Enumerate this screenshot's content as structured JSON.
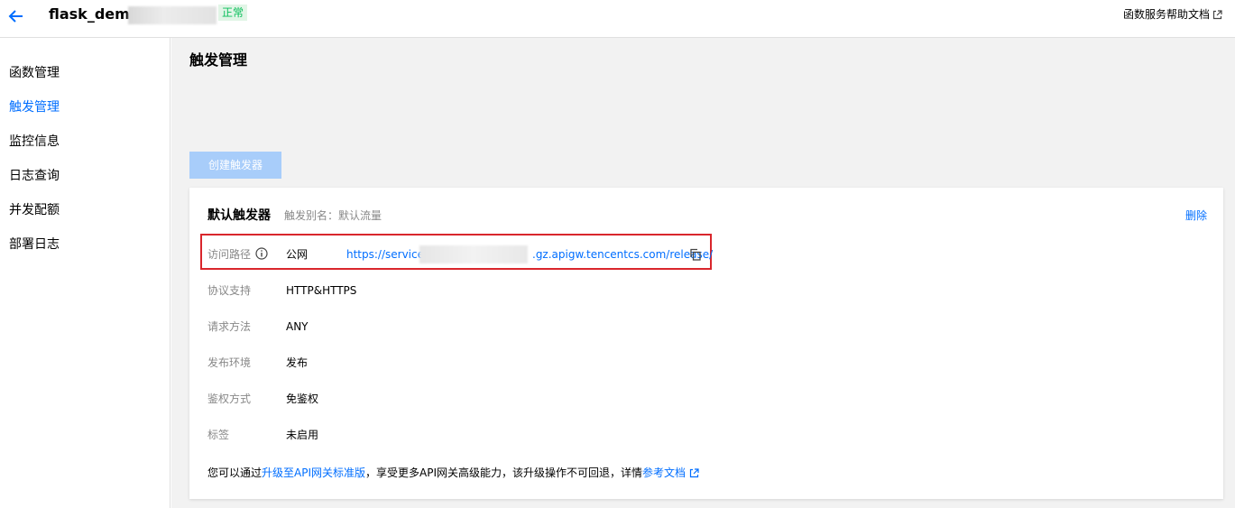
{
  "header": {
    "function_name": "flask_demo-",
    "status": "正常",
    "help_link": "函数服务帮助文档"
  },
  "sidebar": {
    "items": [
      {
        "label": "函数管理"
      },
      {
        "label": "触发管理"
      },
      {
        "label": "监控信息"
      },
      {
        "label": "日志查询"
      },
      {
        "label": "并发配额"
      },
      {
        "label": "部署日志"
      }
    ]
  },
  "main": {
    "title": "触发管理",
    "create_button": "创建触发器",
    "trigger": {
      "title": "默认触发器",
      "alias": "触发别名：默认流量",
      "delete": "删除",
      "access_path_label": "访问路径",
      "access_path_type": "公网",
      "url_prefix": "https://service-",
      "url_suffix": ".gz.apigw.tencentcs.com/release/",
      "protocol_label": "协议支持",
      "protocol_value": "HTTP&HTTPS",
      "method_label": "请求方法",
      "method_value": "ANY",
      "env_label": "发布环境",
      "env_value": "发布",
      "auth_label": "鉴权方式",
      "auth_value": "免鉴权",
      "tag_label": "标签",
      "tag_value": "未启用"
    },
    "note": {
      "prefix": "您可以通过",
      "upgrade_link": "升级至API网关标准版",
      "middle": "，享受更多API网关高级能力，该升级操作不可回退，详情",
      "doc_link": "参考文档"
    }
  },
  "colors": {
    "accent": "#006eff",
    "status_green": "#0abf5b",
    "highlight_red": "#d9262c"
  }
}
